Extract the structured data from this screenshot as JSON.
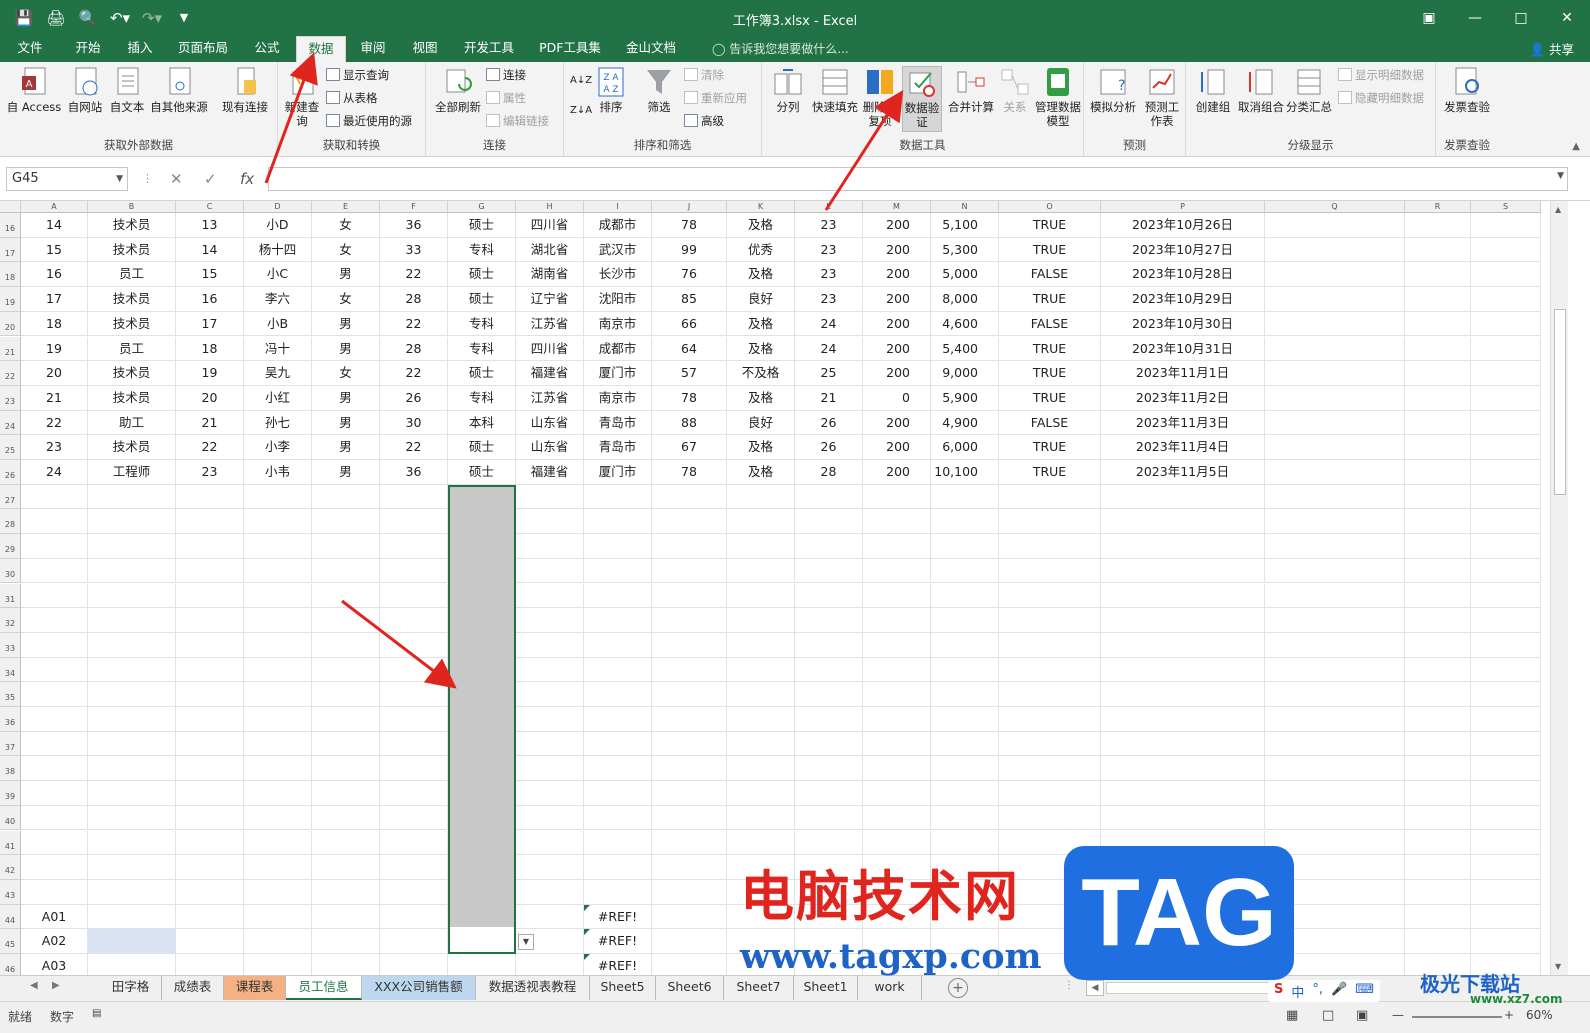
{
  "title": "工作簿3.xlsx - Excel",
  "tabs": [
    "文件",
    "开始",
    "插入",
    "页面布局",
    "公式",
    "数据",
    "审阅",
    "视图",
    "开发工具",
    "PDF工具集",
    "金山文档"
  ],
  "active_tab": "数据",
  "tell_me": "告诉我您想要做什么...",
  "share": "共享",
  "ribbon": {
    "groups": {
      "external": "获取外部数据",
      "transform": "获取和转换",
      "connections": "连接",
      "sortfilter": "排序和筛选",
      "datatools": "数据工具",
      "forecast": "预测",
      "outline": "分级显示",
      "invoice": "发票查验"
    },
    "buttons": {
      "access": "自 Access",
      "web": "自网站",
      "text": "自文本",
      "other": "自其他来源",
      "existing": "现有连接",
      "new_query": "新建查询",
      "show_query": "显示查询",
      "from_table": "从表格",
      "recent": "最近使用的源",
      "refresh_all": "全部刷新",
      "connections": "连接",
      "properties": "属性",
      "edit_links": "编辑链接",
      "sort": "排序",
      "filter": "筛选",
      "clear": "清除",
      "reapply": "重新应用",
      "advanced": "高级",
      "text_to_cols": "分列",
      "flash_fill": "快速填充",
      "remove_dup": "删除重复项",
      "validation": "数据验证",
      "consolidate": "合并计算",
      "relationships": "关系",
      "data_model": "管理数据模型",
      "what_if": "模拟分析",
      "forecast_sheet": "预测工作表",
      "group": "创建组",
      "ungroup": "取消组合",
      "subtotal": "分类汇总",
      "show_detail": "显示明细数据",
      "hide_detail": "隐藏明细数据",
      "invoice": "发票查验"
    }
  },
  "namebox": "G45",
  "columns": [
    "A",
    "B",
    "C",
    "D",
    "E",
    "F",
    "G",
    "H",
    "I",
    "J",
    "K",
    "L",
    "M",
    "N",
    "O",
    "P",
    "Q",
    "R",
    "S"
  ],
  "rows": [
    {
      "n": "16",
      "c": [
        "14",
        "技术员",
        "13",
        "小D",
        "女",
        "36",
        "硕士",
        "四川省",
        "成都市",
        "78",
        "及格",
        "23",
        "200",
        "5,100",
        "TRUE",
        "2023年10月26日"
      ]
    },
    {
      "n": "17",
      "c": [
        "15",
        "技术员",
        "14",
        "杨十四",
        "女",
        "33",
        "专科",
        "湖北省",
        "武汉市",
        "99",
        "优秀",
        "23",
        "200",
        "5,300",
        "TRUE",
        "2023年10月27日"
      ]
    },
    {
      "n": "18",
      "c": [
        "16",
        "员工",
        "15",
        "小C",
        "男",
        "22",
        "硕士",
        "湖南省",
        "长沙市",
        "76",
        "及格",
        "23",
        "200",
        "5,000",
        "FALSE",
        "2023年10月28日"
      ]
    },
    {
      "n": "19",
      "c": [
        "17",
        "技术员",
        "16",
        "李六",
        "女",
        "28",
        "硕士",
        "辽宁省",
        "沈阳市",
        "85",
        "良好",
        "23",
        "200",
        "8,000",
        "TRUE",
        "2023年10月29日"
      ]
    },
    {
      "n": "20",
      "c": [
        "18",
        "技术员",
        "17",
        "小B",
        "男",
        "22",
        "专科",
        "江苏省",
        "南京市",
        "66",
        "及格",
        "24",
        "200",
        "4,600",
        "FALSE",
        "2023年10月30日"
      ]
    },
    {
      "n": "21",
      "c": [
        "19",
        "员工",
        "18",
        "冯十",
        "男",
        "28",
        "专科",
        "四川省",
        "成都市",
        "64",
        "及格",
        "24",
        "200",
        "5,400",
        "TRUE",
        "2023年10月31日"
      ]
    },
    {
      "n": "22",
      "c": [
        "20",
        "技术员",
        "19",
        "吴九",
        "女",
        "22",
        "硕士",
        "福建省",
        "厦门市",
        "57",
        "不及格",
        "25",
        "200",
        "9,000",
        "TRUE",
        "2023年11月1日"
      ]
    },
    {
      "n": "23",
      "c": [
        "21",
        "技术员",
        "20",
        "小红",
        "男",
        "26",
        "专科",
        "江苏省",
        "南京市",
        "78",
        "及格",
        "21",
        "0",
        "5,900",
        "TRUE",
        "2023年11月2日"
      ]
    },
    {
      "n": "24",
      "c": [
        "22",
        "助工",
        "21",
        "孙七",
        "男",
        "30",
        "本科",
        "山东省",
        "青岛市",
        "88",
        "良好",
        "26",
        "200",
        "4,900",
        "FALSE",
        "2023年11月3日"
      ]
    },
    {
      "n": "25",
      "c": [
        "23",
        "技术员",
        "22",
        "小李",
        "男",
        "22",
        "硕士",
        "山东省",
        "青岛市",
        "67",
        "及格",
        "26",
        "200",
        "6,000",
        "TRUE",
        "2023年11月4日"
      ]
    },
    {
      "n": "26",
      "c": [
        "24",
        "工程师",
        "23",
        "小韦",
        "男",
        "36",
        "硕士",
        "福建省",
        "厦门市",
        "78",
        "及格",
        "28",
        "200",
        "10,100",
        "TRUE",
        "2023年11月5日"
      ]
    }
  ],
  "empty_rows": [
    "27",
    "28",
    "29",
    "30",
    "31",
    "32",
    "33",
    "34",
    "35",
    "36",
    "37",
    "38",
    "39",
    "40",
    "41",
    "42",
    "43"
  ],
  "bottom_rows": [
    {
      "n": "44",
      "a": "A01",
      "i": "#REF!"
    },
    {
      "n": "45",
      "a": "A02",
      "i": "#REF!"
    },
    {
      "n": "46",
      "a": "A03",
      "i": "#REF!"
    }
  ],
  "sheets": [
    "田字格",
    "成绩表",
    "课程表",
    "员工信息",
    "XXX公司销售额",
    "数据透视表教程",
    "Sheet5",
    "Sheet6",
    "Sheet7",
    "Sheet1",
    "work"
  ],
  "active_sheet": "员工信息",
  "status": {
    "ready": "就绪",
    "mode": "数字",
    "zoom": "60%"
  },
  "watermark": {
    "cn": "电脑技术网",
    "tag": "TAG",
    "url": "www.tagxp.com",
    "site2": "极光下载站",
    "url2": "www.xz7.com"
  },
  "ime": {
    "lang": "中"
  },
  "colors": {
    "excel_green": "#217346",
    "arrow_red": "#e0251f",
    "selection_gray": "#c8c8c8",
    "tab_orange": "#f4b183",
    "tab_blue": "#bdd7ee"
  }
}
